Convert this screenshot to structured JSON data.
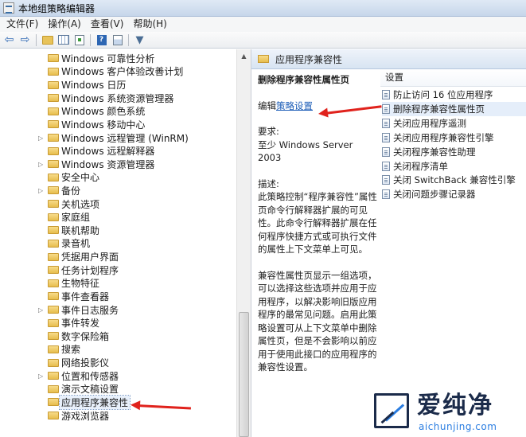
{
  "window": {
    "title": "本地组策略编辑器"
  },
  "menu": [
    "文件(F)",
    "操作(A)",
    "查看(V)",
    "帮助(H)"
  ],
  "toolbar": {
    "icons": [
      "back-arrow-icon",
      "forward-arrow-icon",
      "folder-up-icon",
      "show-hide-tree-icon",
      "export-list-icon",
      "help-icon",
      "properties-view-icon",
      "filter-icon"
    ],
    "back": "⇦",
    "forward": "⇨",
    "help": "?",
    "filter": "▼"
  },
  "tree": {
    "items": [
      {
        "label": "Windows 可靠性分析",
        "expandable": false
      },
      {
        "label": "Windows 客户体验改善计划",
        "expandable": false
      },
      {
        "label": "Windows 日历",
        "expandable": false
      },
      {
        "label": "Windows 系统资源管理器",
        "expandable": false
      },
      {
        "label": "Windows 颜色系统",
        "expandable": false
      },
      {
        "label": "Windows 移动中心",
        "expandable": false
      },
      {
        "label": "Windows 远程管理 (WinRM)",
        "expandable": true
      },
      {
        "label": "Windows 远程解释器",
        "expandable": false
      },
      {
        "label": "Windows 资源管理器",
        "expandable": true
      },
      {
        "label": "安全中心",
        "expandable": false
      },
      {
        "label": "备份",
        "expandable": true
      },
      {
        "label": "关机选项",
        "expandable": false
      },
      {
        "label": "家庭组",
        "expandable": false
      },
      {
        "label": "联机帮助",
        "expandable": false
      },
      {
        "label": "录音机",
        "expandable": false
      },
      {
        "label": "凭据用户界面",
        "expandable": false
      },
      {
        "label": "任务计划程序",
        "expandable": false
      },
      {
        "label": "生物特征",
        "expandable": false
      },
      {
        "label": "事件查看器",
        "expandable": false
      },
      {
        "label": "事件日志服务",
        "expandable": true
      },
      {
        "label": "事件转发",
        "expandable": false
      },
      {
        "label": "数字保险箱",
        "expandable": false
      },
      {
        "label": "搜索",
        "expandable": false
      },
      {
        "label": "网络投影仪",
        "expandable": false
      },
      {
        "label": "位置和传感器",
        "expandable": true
      },
      {
        "label": "演示文稿设置",
        "expandable": false
      },
      {
        "label": "应用程序兼容性",
        "expandable": false,
        "selected": true
      },
      {
        "label": "游戏浏览器",
        "expandable": false
      }
    ],
    "expander_glyph": "▷",
    "scroll_up_glyph": "▲"
  },
  "right": {
    "header": "应用程序兼容性",
    "description": {
      "heading": "删除程序兼容性属性页",
      "edit_prefix": "编辑",
      "edit_link": "策略设置",
      "requirement_label": "要求:",
      "requirement_value": "至少 Windows Server 2003",
      "desc_label": "描述:",
      "desc_p1": "此策略控制“程序兼容性”属性页命令行解释器扩展的可见性。此命令行解释器扩展在任何程序快捷方式或可执行文件的属性上下文菜单上可见。",
      "desc_p2": "兼容性属性页显示一组选项，可以选择这些选项并应用于应用程序，以解决影响旧版应用程序的最常见问题。启用此策略设置可从上下文菜单中删除属性页，但是不会影响以前应用于使用此接口的应用程序的兼容性设置。"
    },
    "settings_header": "设置",
    "settings": [
      {
        "label": "防止访问 16 位应用程序"
      },
      {
        "label": "删除程序兼容性属性页",
        "selected": true
      },
      {
        "label": "关闭应用程序遥测"
      },
      {
        "label": "关闭应用程序兼容性引擎"
      },
      {
        "label": "关闭程序兼容性助理"
      },
      {
        "label": "关闭程序清单"
      },
      {
        "label": "关闭 SwitchBack 兼容性引擎"
      },
      {
        "label": "关闭问题步骤记录器"
      }
    ]
  },
  "annotations": {
    "color": "#e0221c"
  },
  "watermark": {
    "cn": "爱纯净",
    "en": "aichunjing.com"
  }
}
